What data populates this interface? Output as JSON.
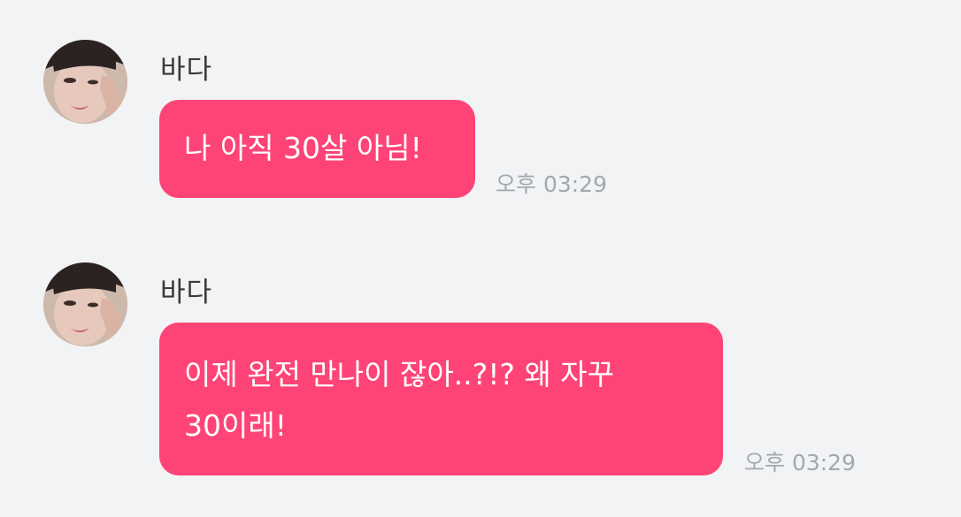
{
  "messages": [
    {
      "sender": "바다",
      "lines": [
        "나 아직 30살 아님!"
      ],
      "time": "오후 03:29"
    },
    {
      "sender": "바다",
      "lines": [
        "이제 완전 만나이 잖아..?!? 왜 자꾸",
        "30이래!"
      ],
      "time": "오후 03:29"
    }
  ],
  "colors": {
    "background": "#f2f3f5",
    "bubble": "#fe4476",
    "bubble_text": "#ffffff",
    "timestamp": "#a4a7ad",
    "sender": "#3a3a3a"
  }
}
